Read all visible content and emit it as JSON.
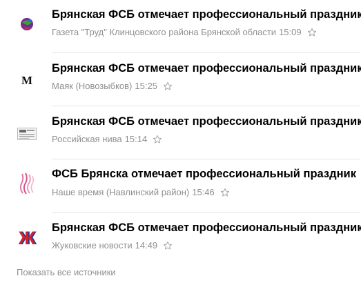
{
  "news": [
    {
      "title": "Брянская ФСБ отмечает профессиональный праздник",
      "source": "Газета \"Труд\" Клинцовского района Брянской области",
      "time": "15:09",
      "logo_icon": "globe-logo-icon"
    },
    {
      "title": "Брянская ФСБ отмечает профессиональный праздник",
      "source": "Маяк (Новозыбков)",
      "time": "15:25",
      "logo_icon": "letter-m-logo-icon",
      "logo_text": "М"
    },
    {
      "title": "Брянская ФСБ отмечает профессиональный праздник",
      "source": "Российская нива",
      "time": "15:14",
      "logo_icon": "newspaper-logo-icon"
    },
    {
      "title": "ФСБ Брянска отмечает профессиональный праздник",
      "source": "Наше время (Навлинский район)",
      "time": "15:46",
      "logo_icon": "pink-waves-logo-icon"
    },
    {
      "title": "Брянская ФСБ отмечает профессиональный праздник",
      "source": "Жуковские новости",
      "time": "14:49",
      "logo_icon": "letter-zh-logo-icon",
      "logo_text": "Ж"
    }
  ],
  "footer": {
    "show_all_label": "Показать все источники"
  },
  "colors": {
    "title": "#000000",
    "meta": "#8f8f8f",
    "divider": "#e6e6e6",
    "zh_red": "#d4202a",
    "zh_blue": "#1e3c9a"
  }
}
